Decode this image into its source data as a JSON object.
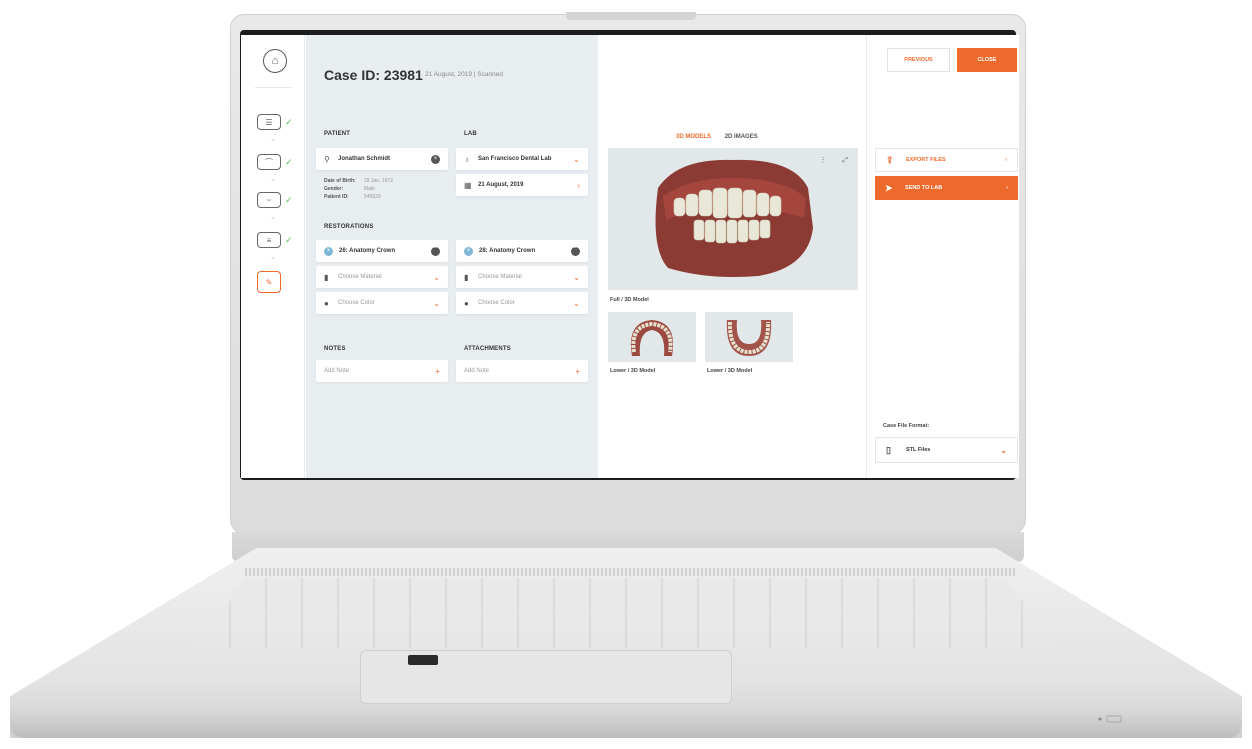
{
  "case": {
    "title": "Case ID: 23981",
    "subtitle": "21 August, 2019 | Scanned"
  },
  "sections": {
    "patient": "PATIENT",
    "lab": "LAB",
    "restorations": "RESTORATIONS",
    "notes": "NOTES",
    "attachments": "ATTACHMENTS"
  },
  "patient": {
    "name": "Jonathan Schmidt",
    "details": [
      {
        "label": "Date of Birth:",
        "value": "29 Jan, 1972"
      },
      {
        "label": "Gender:",
        "value": "Male"
      },
      {
        "label": "Patient ID:",
        "value": "545529"
      }
    ]
  },
  "lab": {
    "name": "San Francisco Dental Lab",
    "date": "21 August, 2019"
  },
  "restorations": [
    {
      "tooth": "26",
      "label": "26: Anatomy Crown",
      "material": "Choose Material",
      "color": "Choose Color"
    },
    {
      "tooth": "28",
      "label": "28: Anatomy Crown",
      "material": "Choose Material",
      "color": "Choose Color"
    }
  ],
  "notes": {
    "placeholder": "Add Note"
  },
  "attachments": {
    "placeholder": "Add Note"
  },
  "viewer": {
    "tabs": [
      {
        "label": "3D MODELS",
        "active": true
      },
      {
        "label": "2D IMAGES",
        "active": false
      }
    ],
    "main_caption": "Full / 3D Model",
    "thumbs": [
      {
        "caption": "Lower / 3D Model"
      },
      {
        "caption": "Lower / 3D Model"
      }
    ]
  },
  "actions": {
    "previous": "PREVIOUS",
    "close": "CLOSE",
    "export": "EXPORT FILES",
    "send": "SEND TO LAB"
  },
  "format": {
    "label": "Case File Format:",
    "value": "STL Files"
  },
  "colors": {
    "accent": "#ee6a2c",
    "check": "#5fb85a",
    "panel": "#e8edf0"
  },
  "icons": [
    "home-icon",
    "prescription-icon",
    "upper-jaw-icon",
    "lower-jaw-icon",
    "bite-icon",
    "send-case-icon",
    "check-icon",
    "user-icon",
    "tooth-lab-icon",
    "calendar-icon",
    "material-icon",
    "color-drop-icon",
    "export-icon",
    "paper-plane-icon",
    "file-icon",
    "chevron-down-icon",
    "chevron-right-icon",
    "plus-icon",
    "more-icon",
    "fullscreen-icon"
  ]
}
